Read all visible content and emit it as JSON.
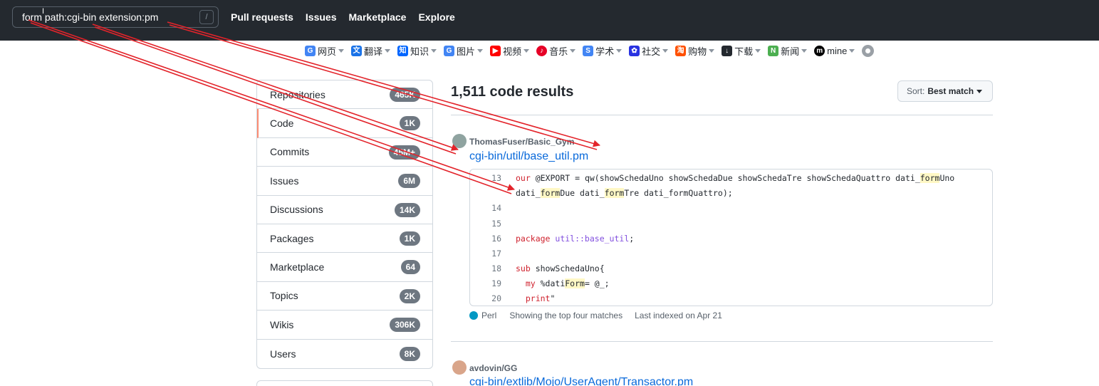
{
  "header": {
    "search_value": "form path:cgi-bin extension:pm",
    "slash_key": "/",
    "nav": [
      "Pull requests",
      "Issues",
      "Marketplace",
      "Explore"
    ]
  },
  "bookmarks": [
    {
      "label": "网页",
      "icon": "google-icon",
      "color": "#4285f4"
    },
    {
      "label": "翻译",
      "icon": "translate-icon",
      "color": "#1a73e8"
    },
    {
      "label": "知识",
      "icon": "zhihu-icon",
      "color": "#0066ff"
    },
    {
      "label": "图片",
      "icon": "google-icon",
      "color": "#4285f4"
    },
    {
      "label": "视频",
      "icon": "youtube-icon",
      "color": "#ff0000"
    },
    {
      "label": "音乐",
      "icon": "netease-music-icon",
      "color": "#e60026"
    },
    {
      "label": "学术",
      "icon": "scholar-icon",
      "color": "#4285f4"
    },
    {
      "label": "社交",
      "icon": "baidu-paw-icon",
      "color": "#2932e1"
    },
    {
      "label": "购物",
      "icon": "taobao-icon",
      "color": "#ff5000"
    },
    {
      "label": "下载",
      "icon": "download-icon",
      "color": "#24292f"
    },
    {
      "label": "新闻",
      "icon": "news-icon",
      "color": "#4caf50"
    },
    {
      "label": "mine",
      "icon": "mine-icon",
      "color": "#000000"
    }
  ],
  "sidebar": {
    "items": [
      {
        "label": "Repositories",
        "count": "465K"
      },
      {
        "label": "Code",
        "count": "1K"
      },
      {
        "label": "Commits",
        "count": "45M+"
      },
      {
        "label": "Issues",
        "count": "6M"
      },
      {
        "label": "Discussions",
        "count": "14K"
      },
      {
        "label": "Packages",
        "count": "1K"
      },
      {
        "label": "Marketplace",
        "count": "64"
      },
      {
        "label": "Topics",
        "count": "2K"
      },
      {
        "label": "Wikis",
        "count": "306K"
      },
      {
        "label": "Users",
        "count": "8K"
      }
    ],
    "selected": "Code"
  },
  "results": {
    "title": "1,511 code results",
    "sort_prefix": "Sort:",
    "sort_value": "Best match"
  },
  "result1": {
    "repo": "ThomasFuser/Basic_Gym",
    "file": "cgi-bin/util/base_util.pm",
    "language": "Perl",
    "language_color": "#0298c3",
    "matches": "Showing the top four matches",
    "indexed": "Last indexed on Apr 21",
    "lines": {
      "n13": "13",
      "n14": "14",
      "n15": "15",
      "n16": "16",
      "n17": "17",
      "n18": "18",
      "n19": "19",
      "n20": "20",
      "l13a_kw": "our",
      "l13a_1": " @EXPORT = qw(showSchedaUno showSchedaDue showSchedaTre showSchedaQuattro dati_",
      "l13a_hl": "form",
      "l13a_2": "Uno",
      "l13b_1": "dati_",
      "l13b_hl1": "form",
      "l13b_2": "Due dati_",
      "l13b_hl2": "form",
      "l13b_3": "Tre dati_formQuattro);",
      "l16_kw": "package",
      "l16_pk": " util::base_util",
      "l16_end": ";",
      "l18_kw": "sub",
      "l18_rest": " showSchedaUno{",
      "l19_kw": "  my",
      "l19_1": " %dati",
      "l19_hl": "Form",
      "l19_2": "= @_;",
      "l20_kw": "  print",
      "l20_rest": "\""
    }
  },
  "result2": {
    "repo": "avdovin/GG",
    "file": "cgi-bin/extlib/Mojo/UserAgent/Transactor.pm"
  },
  "colors": {
    "header_bg": "#24292f",
    "link": "#0969da",
    "arrow": "#e3242b",
    "selected_marker": "#fd8c73"
  }
}
